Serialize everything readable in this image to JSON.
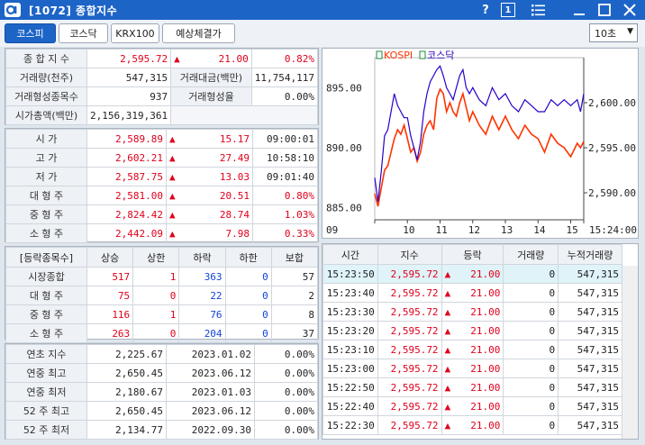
{
  "window": {
    "title": "[1072] 종합지수",
    "help": "?",
    "page_btn": "1"
  },
  "tabs": [
    "코스피",
    "코스닥",
    "KRX100",
    "예상체결가"
  ],
  "interval": "10초",
  "summary": {
    "rows": [
      [
        "종 합 지 수",
        "2,595.72",
        "▲",
        "21.00",
        "0.82%"
      ],
      [
        "거래량(천주)",
        "547,315",
        "거래대금(백만)",
        "11,754,117"
      ],
      [
        "거래형성종목수",
        "937",
        "거래형성율",
        "0.00%"
      ],
      [
        "시가총액(백만)",
        "2,156,319,361"
      ]
    ]
  },
  "prices": [
    {
      "label": "시    가",
      "value": "2,589.89",
      "change": "15.17",
      "extra": "09:00:01"
    },
    {
      "label": "고    가",
      "value": "2,602.21",
      "change": "27.49",
      "extra": "10:58:10"
    },
    {
      "label": "저    가",
      "value": "2,587.75",
      "change": "13.03",
      "extra": "09:01:40"
    },
    {
      "label": "대 형 주",
      "value": "2,581.00",
      "change": "20.51",
      "extra": "0.80%"
    },
    {
      "label": "중 형 주",
      "value": "2,824.42",
      "change": "28.74",
      "extra": "1.03%"
    },
    {
      "label": "소 형 주",
      "value": "2,442.09",
      "change": "7.98",
      "extra": "0.33%"
    }
  ],
  "updown": {
    "headers": [
      "[등락종목수]",
      "상승",
      "상한",
      "하락",
      "하한",
      "보합"
    ],
    "rows": [
      [
        "시장종합",
        "517",
        "1",
        "363",
        "0",
        "57"
      ],
      [
        "대 형 주",
        "75",
        "0",
        "22",
        "0",
        "2"
      ],
      [
        "중 형 주",
        "116",
        "1",
        "76",
        "0",
        "8"
      ],
      [
        "소 형 주",
        "263",
        "0",
        "204",
        "0",
        "37"
      ]
    ]
  },
  "yearly": [
    [
      "연초  지수",
      "2,225.67",
      "2023.01.02",
      "0.00%"
    ],
    [
      "연중  최고",
      "2,650.45",
      "2023.06.12",
      "0.00%"
    ],
    [
      "연중  최저",
      "2,180.67",
      "2023.01.03",
      "0.00%"
    ],
    [
      "52 주 최고",
      "2,650.45",
      "2023.06.12",
      "0.00%"
    ],
    [
      "52 주 최저",
      "2,134.77",
      "2022.09.30",
      "0.00%"
    ]
  ],
  "ticks": {
    "headers": [
      "시간",
      "지수",
      "등락",
      "거래량",
      "누적거래량"
    ],
    "rows": [
      [
        "15:23:50",
        "2,595.72",
        "21.00",
        "0",
        "547,315"
      ],
      [
        "15:23:40",
        "2,595.72",
        "21.00",
        "0",
        "547,315"
      ],
      [
        "15:23:30",
        "2,595.72",
        "21.00",
        "0",
        "547,315"
      ],
      [
        "15:23:20",
        "2,595.72",
        "21.00",
        "0",
        "547,315"
      ],
      [
        "15:23:10",
        "2,595.72",
        "21.00",
        "0",
        "547,315"
      ],
      [
        "15:23:00",
        "2,595.72",
        "21.00",
        "0",
        "547,315"
      ],
      [
        "15:22:50",
        "2,595.72",
        "21.00",
        "0",
        "547,315"
      ],
      [
        "15:22:40",
        "2,595.72",
        "21.00",
        "0",
        "547,315"
      ],
      [
        "15:22:30",
        "2,595.72",
        "21.00",
        "0",
        "547,315"
      ]
    ]
  },
  "colors": {
    "kospi": "#ff3300",
    "kosdaq": "#2a00c8",
    "up": "#e0001b",
    "titlebar": "#1d64c7"
  },
  "chart_data": {
    "type": "line",
    "legend": [
      "KOSPI",
      "코스닥"
    ],
    "x_ticks": [
      "09",
      "10",
      "11",
      "12",
      "13",
      "14",
      "15",
      "15:24:00"
    ],
    "y_left_ticks": [
      "895.00",
      "890.00",
      "885.00"
    ],
    "y_right_ticks": [
      "2,600.00",
      "2,595.00",
      "2,590.00"
    ],
    "y_left_range": [
      884,
      897.5
    ],
    "y_right_range": [
      2587,
      2605
    ],
    "series": [
      {
        "name": "KOSPI",
        "axis": "right",
        "x": [
          9.0,
          9.1,
          9.2,
          9.3,
          9.4,
          9.5,
          9.6,
          9.7,
          9.8,
          9.9,
          10.0,
          10.1,
          10.2,
          10.3,
          10.4,
          10.5,
          10.6,
          10.7,
          10.8,
          10.9,
          11.0,
          11.1,
          11.2,
          11.3,
          11.4,
          11.5,
          11.6,
          11.7,
          11.8,
          11.9,
          12.0,
          12.2,
          12.4,
          12.6,
          12.8,
          13.0,
          13.2,
          13.4,
          13.6,
          13.8,
          14.0,
          14.2,
          14.4,
          14.6,
          14.8,
          15.0,
          15.2,
          15.3,
          15.4
        ],
        "values": [
          2589.9,
          2588.5,
          2590.5,
          2592.5,
          2593.0,
          2594.5,
          2596.0,
          2597.0,
          2596.5,
          2597.5,
          2596.0,
          2594.5,
          2595.0,
          2593.5,
          2594.5,
          2596.5,
          2597.5,
          2598.0,
          2597.0,
          2600.5,
          2601.5,
          2601.0,
          2599.0,
          2600.0,
          2599.0,
          2598.5,
          2600.0,
          2601.0,
          2599.5,
          2598.0,
          2599.0,
          2597.5,
          2596.5,
          2598.5,
          2597.0,
          2598.5,
          2597.0,
          2596.0,
          2597.5,
          2596.5,
          2596.0,
          2594.5,
          2596.5,
          2595.5,
          2595.0,
          2594.0,
          2595.5,
          2595.0,
          2595.7
        ]
      },
      {
        "name": "코스닥",
        "axis": "left",
        "x": [
          9.0,
          9.1,
          9.2,
          9.3,
          9.4,
          9.5,
          9.6,
          9.7,
          9.8,
          9.9,
          10.0,
          10.1,
          10.2,
          10.3,
          10.4,
          10.5,
          10.6,
          10.7,
          10.8,
          10.9,
          11.0,
          11.1,
          11.2,
          11.3,
          11.4,
          11.5,
          11.6,
          11.7,
          11.8,
          11.9,
          12.0,
          12.2,
          12.4,
          12.6,
          12.8,
          13.0,
          13.2,
          13.4,
          13.6,
          13.8,
          14.0,
          14.2,
          14.4,
          14.6,
          14.8,
          15.0,
          15.2,
          15.3,
          15.4
        ],
        "values": [
          887.5,
          885.5,
          888.0,
          891.0,
          891.5,
          893.0,
          894.5,
          893.5,
          893.0,
          892.5,
          892.5,
          891.0,
          890.0,
          889.0,
          890.5,
          893.0,
          894.5,
          895.5,
          896.0,
          896.5,
          896.8,
          896.0,
          895.0,
          894.5,
          894.0,
          895.0,
          896.0,
          896.5,
          895.0,
          894.5,
          895.0,
          894.0,
          893.5,
          895.0,
          894.0,
          894.5,
          893.5,
          893.0,
          894.0,
          893.5,
          893.0,
          893.0,
          894.0,
          893.5,
          894.0,
          893.5,
          894.0,
          893.0,
          894.5
        ]
      }
    ]
  }
}
